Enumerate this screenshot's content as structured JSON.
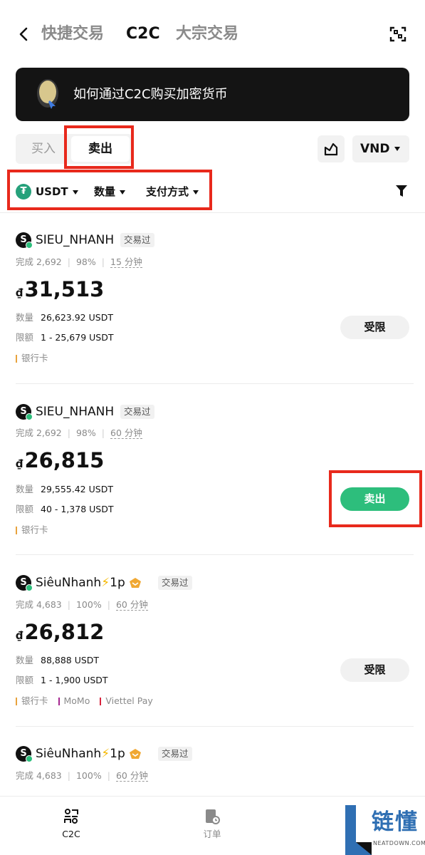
{
  "nav": {
    "tabs": [
      "快捷交易",
      "C2C",
      "大宗交易"
    ],
    "active_tab": "C2C"
  },
  "banner": {
    "text": "如何通过C2C购买加密货币"
  },
  "side_toggle": {
    "buy": "买入",
    "sell": "卖出",
    "active": "卖出"
  },
  "currency": "VND",
  "filters": {
    "coin": "USDT",
    "amount": "数量",
    "payment": "支付方式"
  },
  "listings": [
    {
      "avatar_letter": "S",
      "name": "SIEU_NHANH",
      "traded_badge": "交易过",
      "completed": "完成 2,692",
      "rate": "98%",
      "time": "15 分钟",
      "currency_symbol": "₫",
      "price": "31,513",
      "qty_label": "数量",
      "qty": "26,623.92 USDT",
      "limit_label": "限额",
      "limit": "1 - 25,679 USDT",
      "payments": [
        {
          "name": "银行卡",
          "color": "#e8a33d"
        }
      ],
      "action": "受限",
      "action_type": "limited"
    },
    {
      "avatar_letter": "S",
      "name": "SIEU_NHANH",
      "traded_badge": "交易过",
      "completed": "完成 2,692",
      "rate": "98%",
      "time": "60 分钟",
      "currency_symbol": "₫",
      "price": "26,815",
      "qty_label": "数量",
      "qty": "29,555.42 USDT",
      "limit_label": "限额",
      "limit": "40 - 1,378 USDT",
      "payments": [
        {
          "name": "银行卡",
          "color": "#e8a33d"
        }
      ],
      "action": "卖出",
      "action_type": "sell"
    },
    {
      "avatar_letter": "S",
      "name": "SiêuNhanh",
      "name_suffix": "1p",
      "traded_badge": "交易过",
      "completed": "完成 4,683",
      "rate": "100%",
      "time": "60 分钟",
      "currency_symbol": "₫",
      "price": "26,812",
      "qty_label": "数量",
      "qty": "88,888 USDT",
      "limit_label": "限额",
      "limit": "1 - 1,900 USDT",
      "payments": [
        {
          "name": "银行卡",
          "color": "#e8a33d"
        },
        {
          "name": "MoMo",
          "color": "#a5278f"
        },
        {
          "name": "Viettel Pay",
          "color": "#d8233d"
        }
      ],
      "action": "受限",
      "action_type": "limited"
    },
    {
      "avatar_letter": "S",
      "name": "SiêuNhanh",
      "name_suffix": "1p",
      "traded_badge": "交易过",
      "completed": "完成 4,683",
      "rate": "100%",
      "time": "60 分钟"
    }
  ],
  "bottom_nav": [
    {
      "label": "C2C",
      "active": true
    },
    {
      "label": "订单",
      "active": false
    }
  ],
  "watermark": {
    "text": "链懂",
    "sub": "NEATDOWN.COM"
  },
  "colors": {
    "accent_green": "#2dbe7c",
    "highlight_red": "#e8291c",
    "banner_bg": "#141414"
  }
}
